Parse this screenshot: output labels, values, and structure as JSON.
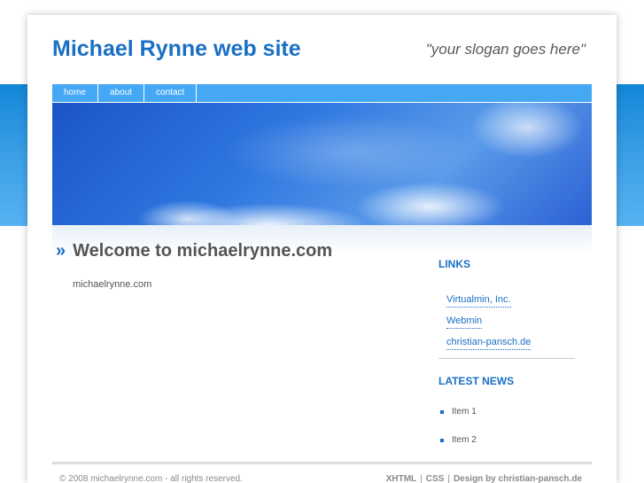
{
  "header": {
    "title": "Michael Rynne web site",
    "slogan": "\"your slogan goes here\""
  },
  "nav": {
    "items": [
      {
        "label": "home"
      },
      {
        "label": "about"
      },
      {
        "label": "contact"
      }
    ]
  },
  "main": {
    "raquo": "»",
    "heading": "Welcome to michaelrynne.com",
    "text": "michaelrynne.com"
  },
  "sidebar": {
    "links_heading": "LINKS",
    "links": [
      {
        "label": "Virtualmin, Inc."
      },
      {
        "label": "Webmin"
      },
      {
        "label": "christian-pansch.de"
      }
    ],
    "news_heading": "LATEST NEWS",
    "news": [
      {
        "label": "Item 1"
      },
      {
        "label": "Item 2"
      }
    ]
  },
  "footer": {
    "copyright": "© 2008 michaelrynne.com - all rights reserved.",
    "xhtml": "XHTML",
    "css": "CSS",
    "separator": "|",
    "design": "Design by christian-pansch.de"
  },
  "colors": {
    "accent": "#1a6fc4",
    "nav_bg": "#45a8f5",
    "band": "#1486d8"
  }
}
